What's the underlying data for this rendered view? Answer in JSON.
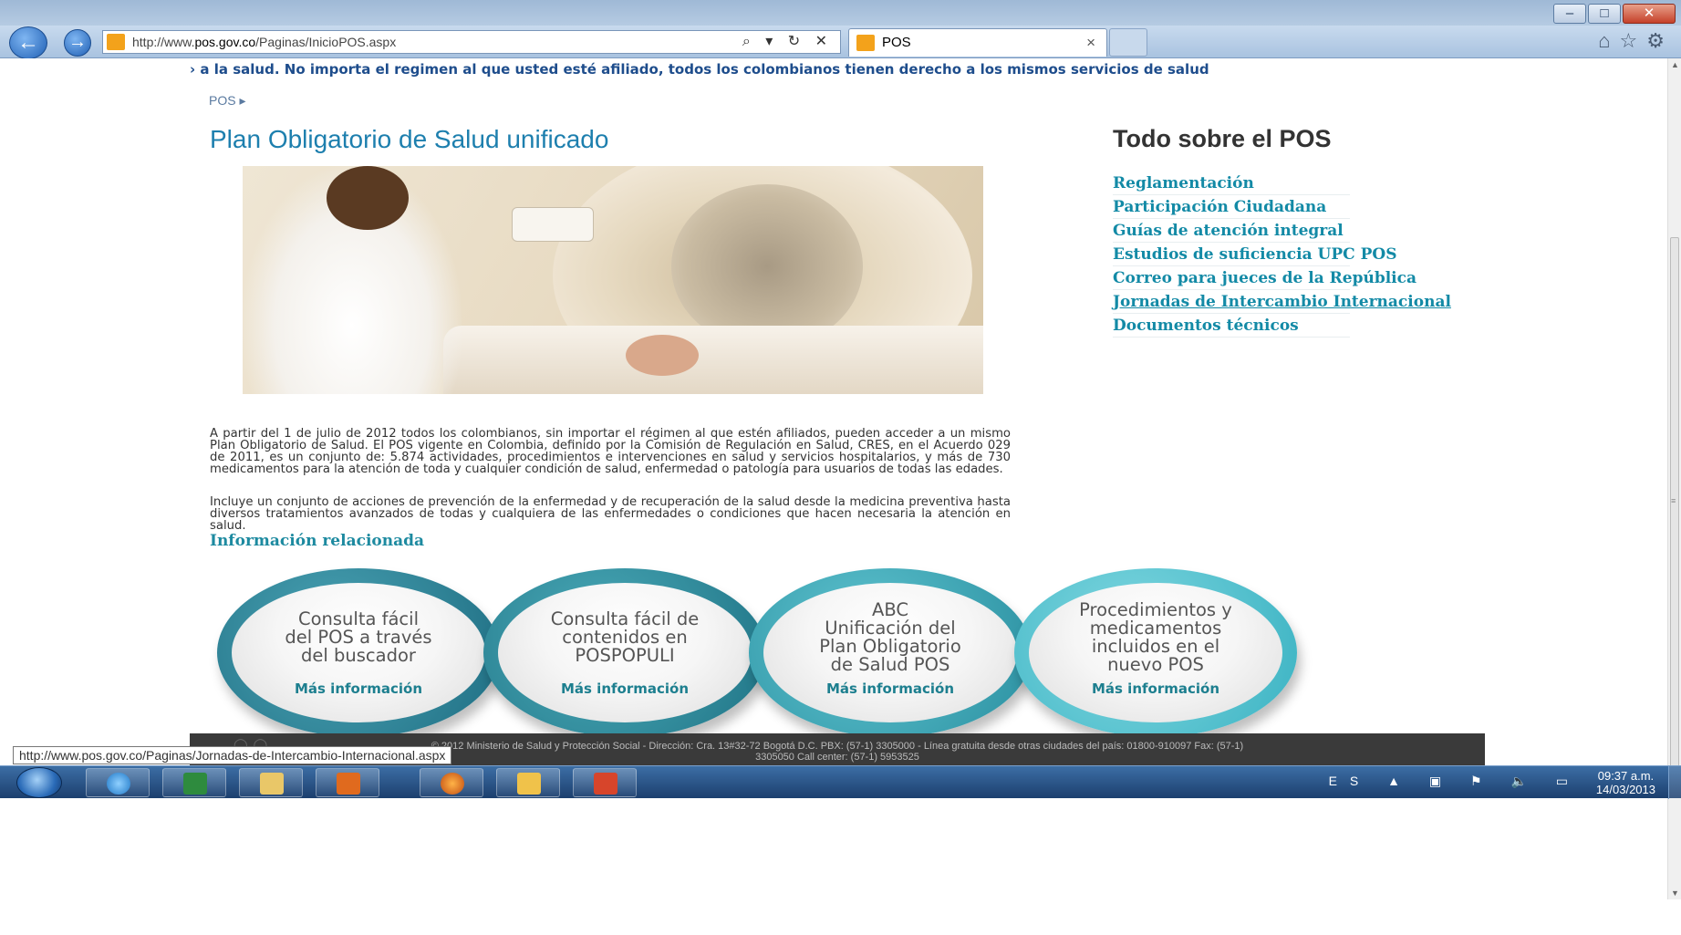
{
  "browser": {
    "url_prefix": "http://www.",
    "url_domain": "pos.gov.co",
    "url_path": "/Paginas/InicioPOS.aspx",
    "addr_icons": "⌕ ▾ ↻ ✕",
    "tab_title": "POS",
    "tab_close": "×"
  },
  "page": {
    "ticker": "› a la salud. No importa el regimen al que usted esté afiliado, todos los colombianos tienen derecho a los mismos servicios de salud",
    "breadcrumb": "POS ▸",
    "title": "Plan Obligatorio de Salud unificado",
    "paragraph1": "A partir del 1 de julio de 2012 todos los colombianos, sin importar el régimen al que estén afiliados, pueden acceder a un mismo Plan Obligatorio de Salud. El POS vigente en Colombia, definido por la Comisión de Regulación en Salud, CRES, en el Acuerdo 029 de 2011, es un conjunto de: 5.874 actividades, procedimientos e intervenciones en salud y servicios hospitalarios, y más de 730 medicamentos para la atención de toda y cualquier condición de salud, enfermedad o patología para usuarios de todas las edades.",
    "paragraph2": "Incluye un conjunto de acciones de prevención de la enfermedad y de recuperación de la salud desde la medicina preventiva hasta diversos tratamientos avanzados de todas y cualquiera de las enfermedades o condiciones que hacen necesaria la atención en salud.",
    "related_heading": "Información relacionada",
    "circles": [
      {
        "title": "Consulta fácil\ndel POS a través\ndel buscador",
        "more": "Más información"
      },
      {
        "title": "Consulta fácil de\ncontenidos en\nPOSPOPULI",
        "more": "Más información"
      },
      {
        "title": "ABC\nUnificación del\nPlan Obligatorio\nde Salud POS",
        "more": "Más información"
      },
      {
        "title": "Procedimientos y\nmedicamentos\nincluidos en el\nnuevo POS",
        "more": "Más información"
      }
    ]
  },
  "sidebar": {
    "title": "Todo sobre el POS",
    "links": [
      "Reglamentación",
      "Participación Ciudadana",
      "Guías de atención integral",
      "Estudios de suficiencia UPC POS",
      "Correo para jueces de la República",
      "Jornadas de Intercambio Internacional",
      "Documentos técnicos"
    ]
  },
  "footer": {
    "line1": "© 2012 Ministerio de Salud y Protección Social - Dirección: Cra. 13#32-72 Bogotá D.C. PBX: (57-1) 3305000 - Línea gratuita desde otras ciudades del país: 01800-910097 Fax: (57-1)",
    "line2": "3305050 Call center: (57-1) 5953525"
  },
  "status_url": "http://www.pos.gov.co/Paginas/Jornadas-de-Intercambio-Internacional.aspx",
  "taskbar": {
    "language": "ES",
    "time": "09:37 a.m.",
    "date": "14/03/2013"
  }
}
